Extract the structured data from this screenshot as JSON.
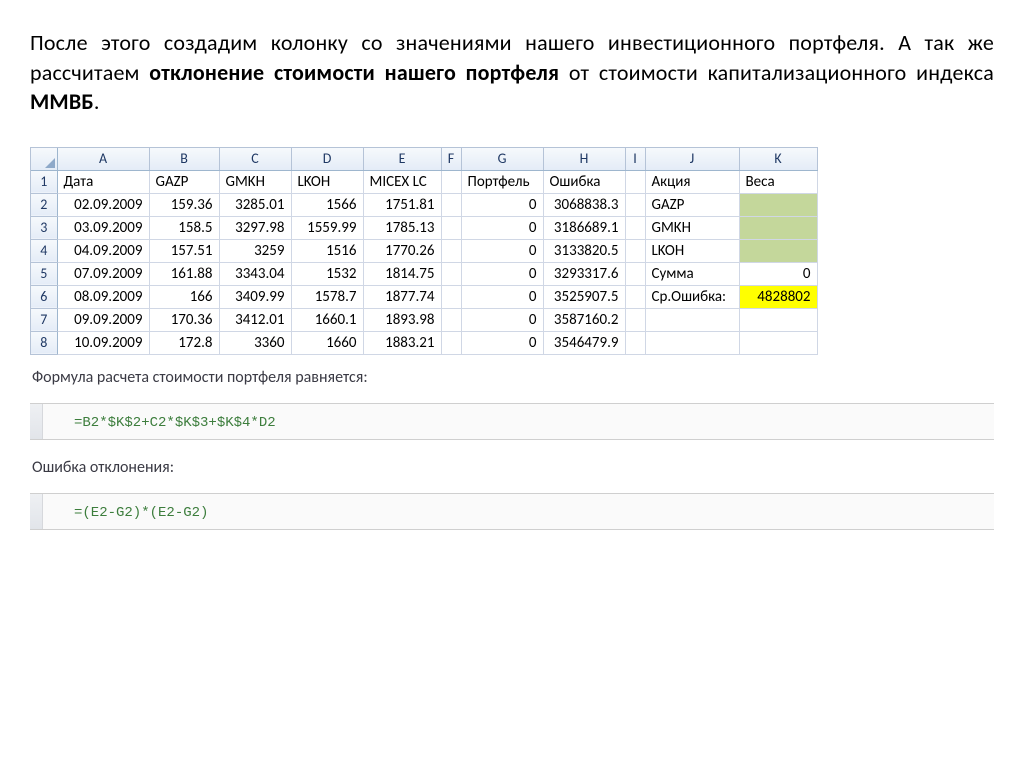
{
  "paragraph": {
    "part1": "После этого создадим колонку со значениями нашего инвестиционного портфеля. А так же рассчитаем ",
    "bold1": "отклонение стоимости нашего портфеля",
    "part2": " от стоимости капитализационного индекса  ",
    "bold2": "ММВБ",
    "part3": "."
  },
  "columns": [
    "A",
    "B",
    "C",
    "D",
    "E",
    "F",
    "G",
    "H",
    "I",
    "J",
    "K"
  ],
  "row_ids": [
    "1",
    "2",
    "3",
    "4",
    "5",
    "6",
    "7",
    "8"
  ],
  "header_row": {
    "A": "Дата",
    "B": "GAZP",
    "C": "GMKH",
    "D": "LKOH",
    "E": "MICEX LC",
    "F": "",
    "G": "Портфель",
    "H": "Ошибка",
    "I": "",
    "J": "Акция",
    "K": "Веса"
  },
  "rows": [
    {
      "A": "02.09.2009",
      "B": "159.36",
      "C": "3285.01",
      "D": "1566",
      "E": "1751.81",
      "F": "",
      "G": "0",
      "H": "3068838.3",
      "I": "",
      "J": "GAZP",
      "K": "",
      "K_class": "hl-green"
    },
    {
      "A": "03.09.2009",
      "B": "158.5",
      "C": "3297.98",
      "D": "1559.99",
      "E": "1785.13",
      "F": "",
      "G": "0",
      "H": "3186689.1",
      "I": "",
      "J": "GMKH",
      "K": "",
      "K_class": "hl-green"
    },
    {
      "A": "04.09.2009",
      "B": "157.51",
      "C": "3259",
      "D": "1516",
      "E": "1770.26",
      "F": "",
      "G": "0",
      "H": "3133820.5",
      "I": "",
      "J": "LKOH",
      "K": "",
      "K_class": "hl-green"
    },
    {
      "A": "07.09.2009",
      "B": "161.88",
      "C": "3343.04",
      "D": "1532",
      "E": "1814.75",
      "F": "",
      "G": "0",
      "H": "3293317.6",
      "I": "",
      "J": "Сумма",
      "K": "0",
      "J_bold": true
    },
    {
      "A": "08.09.2009",
      "B": "166",
      "C": "3409.99",
      "D": "1578.7",
      "E": "1877.74",
      "F": "",
      "G": "0",
      "H": "3525907.5",
      "I": "",
      "J": "Ср.Ошибка:",
      "K": "4828802",
      "J_bold": true,
      "K_class": "hl-yellow"
    },
    {
      "A": "09.09.2009",
      "B": "170.36",
      "C": "3412.01",
      "D": "1660.1",
      "E": "1893.98",
      "F": "",
      "G": "0",
      "H": "3587160.2",
      "I": "",
      "J": "",
      "K": ""
    },
    {
      "A": "10.09.2009",
      "B": "172.8",
      "C": "3360",
      "D": "1660",
      "E": "1883.21",
      "F": "",
      "G": "0",
      "H": "3546479.9",
      "I": "",
      "J": "",
      "K": ""
    }
  ],
  "note1": "Формула расчета стоимости портфеля равняется:",
  "formula1": "=B2*$K$2+C2*$K$3+$K$4*D2",
  "note2": "Ошибка отклонения:",
  "formula2": "=(E2-G2)*(E2-G2)"
}
